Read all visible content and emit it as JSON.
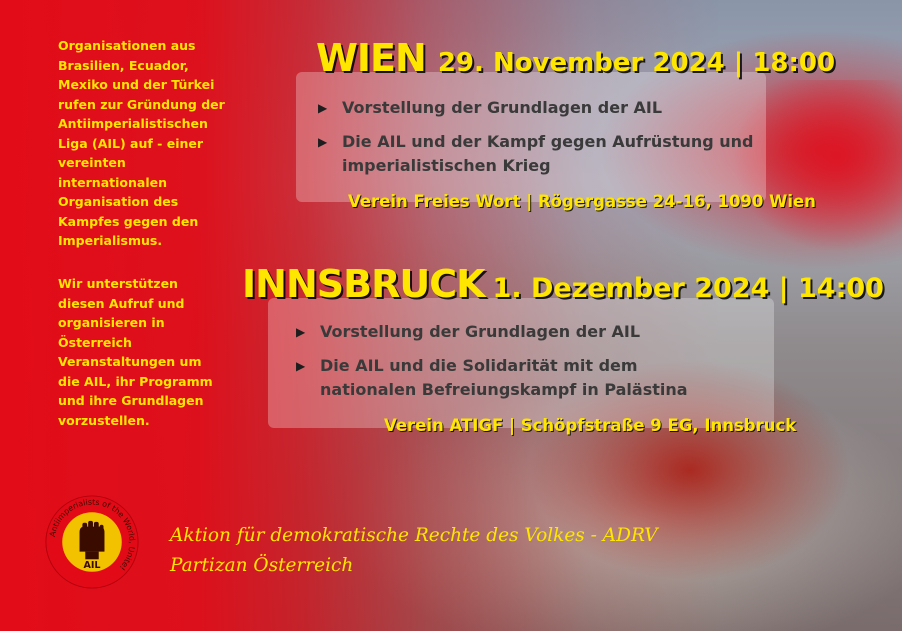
{
  "intro": {
    "paragraph1": "Organisationen aus Brasilien, Ecuador, Mexiko und der Türkei rufen zur Gründung der Antiimperialistischen Liga (AIL) auf - einer vereinten internationalen Organisation des Kampfes gegen den Imperialismus.",
    "paragraph2": "Wir unterstützen diesen Aufruf und organisieren in Österreich Veranstaltungen um die AIL, ihr Programm und ihre Grundlagen vorzustellen."
  },
  "events": {
    "wien": {
      "city": "WIEN",
      "date": "29. November 2024 | 18:00",
      "items": [
        "Vorstellung der Grundlagen der AIL",
        "Die AIL und der Kampf gegen Aufrüstung und imperialistischen Krieg"
      ],
      "venue": "Verein Freies Wort | Rögergasse 24-16, 1090 Wien"
    },
    "innsbruck": {
      "city": "INNSBRUCK",
      "date": "1. Dezember 2024 | 14:00",
      "items": [
        "Vorstellung der Grundlagen der AIL",
        "Die AIL und die Solidarität mit dem nationalen Befreiungskampf in Palästina"
      ],
      "venue": "Verein ATIGF | Schöpfstraße 9 EG, Innsbruck"
    }
  },
  "logo": {
    "ring_text": "Antiimperialists of the World, Unite!",
    "acronym": "AIL"
  },
  "organization": {
    "line1": "Aktion für demokratische Rechte des Volkes - ADRV",
    "line2": "Partizan Österreich"
  },
  "colors": {
    "accent_yellow": "#ffe600",
    "primary_red": "#e20c18",
    "bullet_text": "#3a3a3a"
  },
  "icons": {
    "bullet": "triangle-right-icon",
    "logo": "raised-fist-icon"
  }
}
